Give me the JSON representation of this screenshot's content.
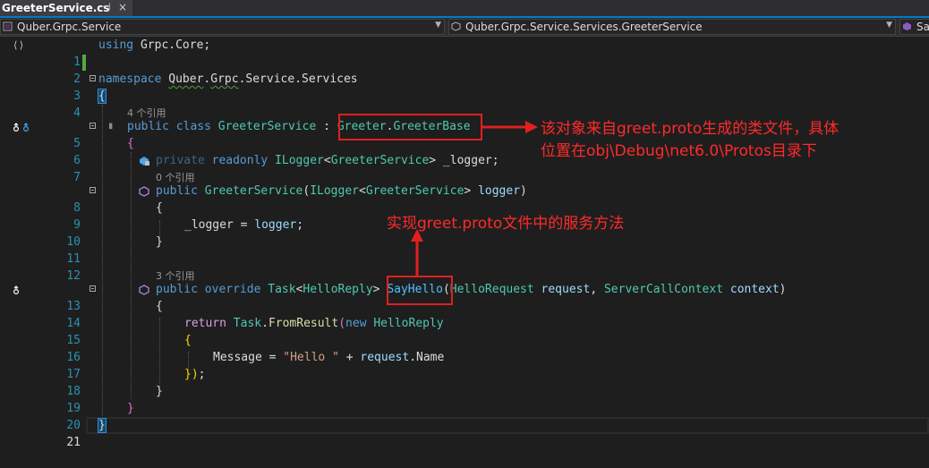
{
  "tab": {
    "title": "GreeterService.cs",
    "pin": "⊣",
    "close": "×"
  },
  "nav": {
    "project": "Quber.Grpc.Service",
    "type": "Quber.Grpc.Service.Services.GreeterService",
    "member": "Sa"
  },
  "glyphs": {
    "namespace_icon": "⟨⟩"
  },
  "lens": {
    "line4": "4 个引用",
    "line7": "0 个引用",
    "line13": "3 个引用"
  },
  "line_numbers": [
    "1",
    "2",
    "3",
    "4",
    "5",
    "6",
    "7",
    "8",
    "9",
    "10",
    "11",
    "12",
    "13",
    "14",
    "15",
    "16",
    "17",
    "18",
    "19",
    "20",
    "21"
  ],
  "code": {
    "l1": {
      "kw": "using",
      "rest": " Grpc.Core;"
    },
    "l3": {
      "kw": "namespace",
      "ns1": "Quber",
      "dot1": ".",
      "ns2": "Grpc",
      "dot2": ".",
      "ns3": "Service",
      "dot3": ".",
      "ns4": "Services"
    },
    "l4": {
      "brace": "{"
    },
    "l5": {
      "mod1": "public",
      "mod2": "class",
      "name": "GreeterService",
      "colon": " : ",
      "base1": "Greeter",
      "dot": ".",
      "base2": "GreeterBase"
    },
    "l6": {
      "brace": "{"
    },
    "l7": {
      "mod1": "private",
      "mod2": "readonly",
      "t1": "ILogger",
      "lt": "<",
      "t2": "GreeterService",
      "gt": ">",
      "field": " _logger;"
    },
    "l8": {
      "mod": "public",
      "ctor": "GreeterService",
      "p1": "(",
      "t1": "ILogger",
      "lt": "<",
      "t2": "GreeterService",
      "gt": ">",
      "param": "logger",
      "p2": ")"
    },
    "l9": {
      "brace": "{"
    },
    "l10": {
      "field": "_logger",
      "eq": " = ",
      "param": "logger",
      "semi": ";"
    },
    "l11": {
      "brace": "}"
    },
    "l13": {
      "mod1": "public",
      "mod2": "override",
      "t1": "Task",
      "lt": "<",
      "t2": "HelloReply",
      "gt": ">",
      "meth": "SayHello",
      "p1": "(",
      "t3": "HelloRequest",
      "a1": "request",
      "comma": ", ",
      "t4": "ServerCallContext",
      "a2": "context",
      "p2": ")"
    },
    "l14": {
      "brace": "{"
    },
    "l15": {
      "kw": "return",
      "t1": "Task",
      "dot": ".",
      "meth": "FromResult",
      "p": "(",
      "kw2": "new",
      "t2": "HelloReply"
    },
    "l16": {
      "brace": "{"
    },
    "l17": {
      "prop": "Message",
      "eq": " = ",
      "str": "\"Hello \"",
      "plus": " + ",
      "param": "request",
      "dot": ".",
      "prop2": "Name"
    },
    "l18": {
      "close": "})",
      "semi": ";"
    },
    "l19": {
      "brace": "}"
    },
    "l20": {
      "brace": "}"
    },
    "l21": {
      "brace": "}"
    }
  },
  "annotations": {
    "base_note_line1": "该对象来自greet.proto生成的类文件，具体",
    "base_note_line2": "位置在obj\\Debug\\net6.0\\Protos目录下",
    "method_note": "实现greet.proto文件中的服务方法"
  },
  "colors": {
    "accent": "#007acc",
    "annotation_red": "#e02020"
  }
}
